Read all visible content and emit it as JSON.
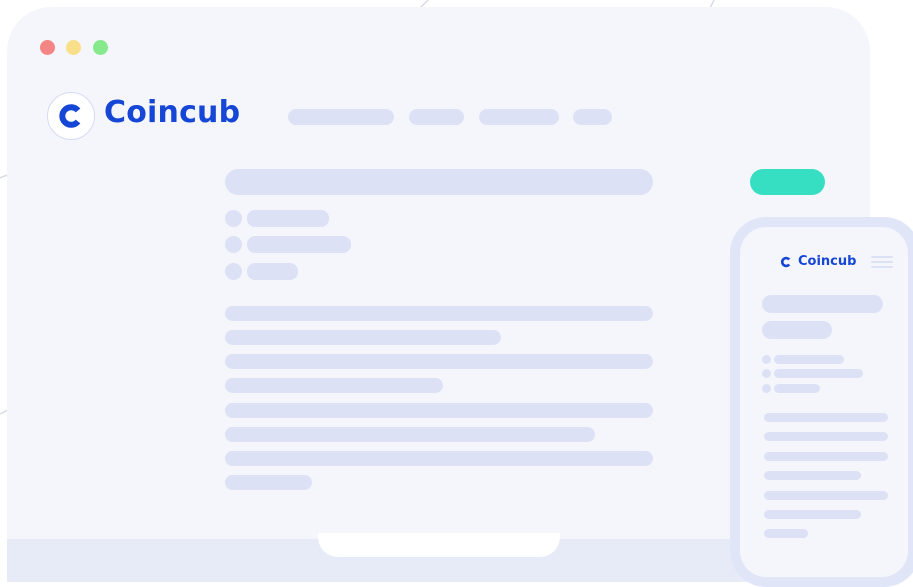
{
  "brand": {
    "name": "Coincub",
    "color": "#1546d6",
    "logo_icon": "coincub-c-icon"
  },
  "window": {
    "controls": [
      "close-dot",
      "minimize-dot",
      "maximize-dot"
    ],
    "control_colors": [
      "#f48585",
      "#f9df8a",
      "#86ea8c"
    ]
  },
  "colors": {
    "page_bg": "#f5f6fb",
    "placeholder": "#dde1f5",
    "accent": "#37dfc2"
  },
  "mobile": {
    "brand_name": "Coincub",
    "menu_icon": "hamburger-menu-icon"
  }
}
